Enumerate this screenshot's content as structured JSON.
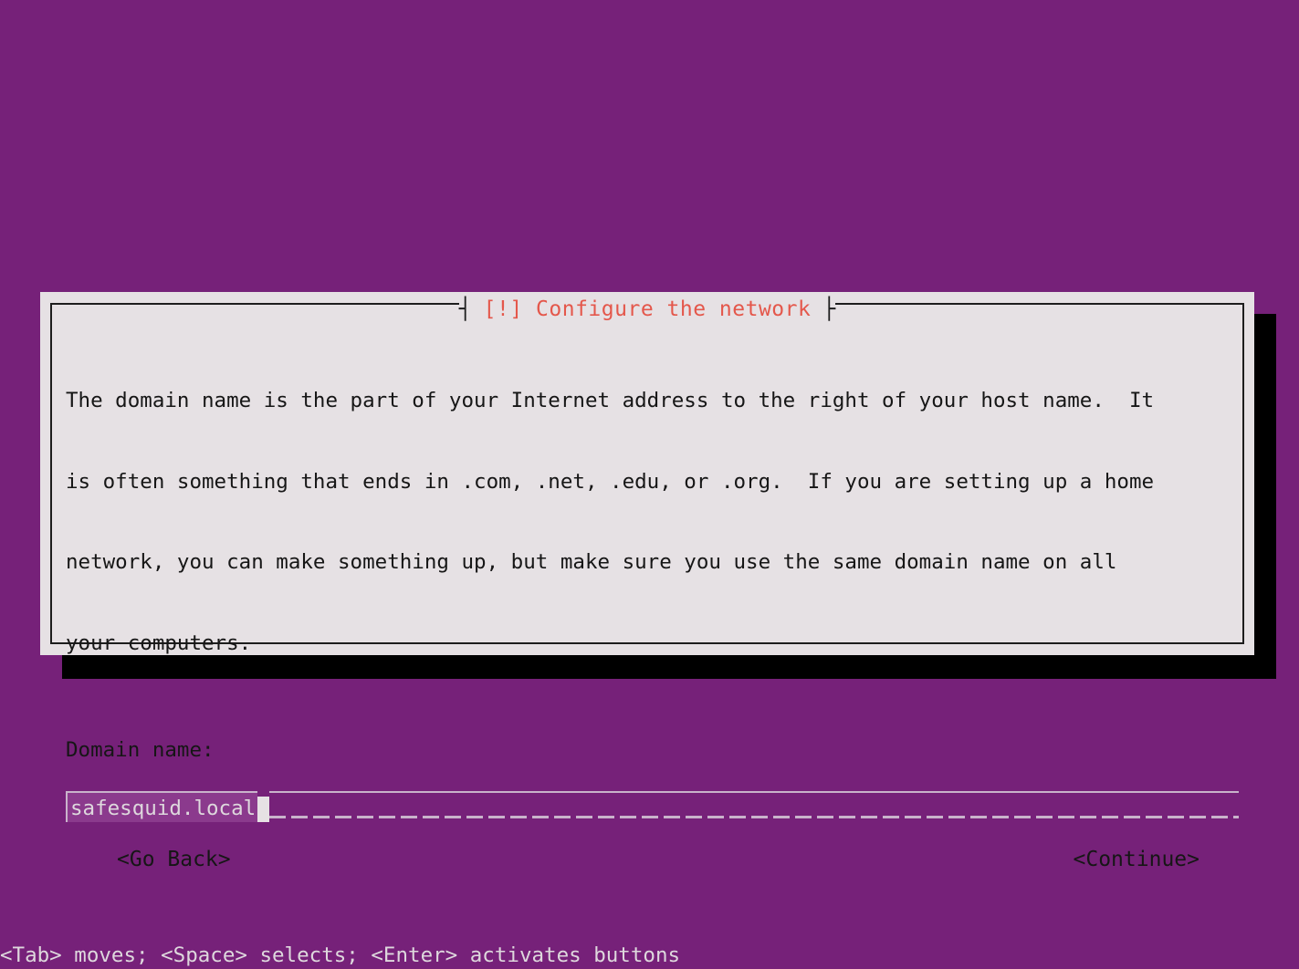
{
  "screen": {
    "background_color": "#762179",
    "foreground_color": "#ded8dd"
  },
  "dialog": {
    "title": "[!] Configure the network",
    "title_color": "#e4574b",
    "background_color": "#e6e1e4",
    "border_color": "#1d1d1d",
    "tick_left": "┤",
    "tick_right": "├",
    "description_lines": [
      "The domain name is the part of your Internet address to the right of your host name.  It",
      "is often something that ends in .com, .net, .edu, or .org.  If you are setting up a home",
      "network, you can make something up, but make sure you use the same domain name on all",
      "your computers."
    ],
    "field": {
      "label": "Domain name:",
      "value": "safesquid.local",
      "placeholder": "",
      "value_background_color": "#8b3a8d",
      "field_background_color": "#762179",
      "value_text_color": "#ded8dd"
    },
    "buttons": {
      "go_back": "<Go Back>",
      "continue": "<Continue>"
    }
  },
  "status_bar": {
    "text": "<Tab> moves; <Space> selects; <Enter> activates buttons"
  }
}
